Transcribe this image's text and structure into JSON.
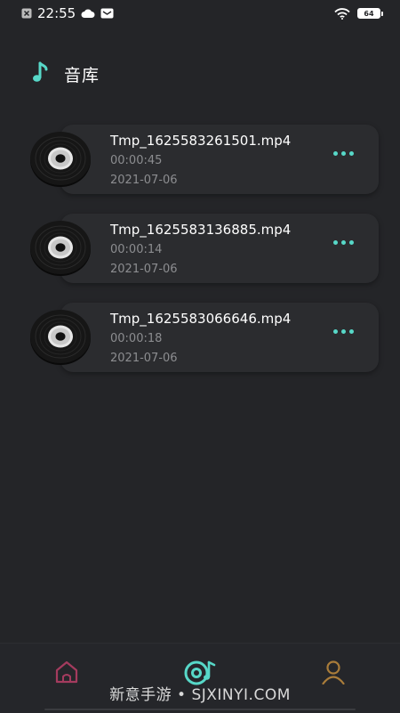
{
  "status_bar": {
    "time": "22:55",
    "battery": "64",
    "icons": [
      "close-box-icon",
      "weather-icon",
      "message-icon",
      "wifi-icon",
      "battery-icon"
    ]
  },
  "header": {
    "title": "音库",
    "icon": "music-note-icon"
  },
  "files": [
    {
      "name": "Tmp_1625583261501.mp4",
      "duration": "00:00:45",
      "date": "2021-07-06"
    },
    {
      "name": "Tmp_1625583136885.mp4",
      "duration": "00:00:14",
      "date": "2021-07-06"
    },
    {
      "name": "Tmp_1625583066646.mp4",
      "duration": "00:00:18",
      "date": "2021-07-06"
    }
  ],
  "bottom_nav": {
    "items": [
      {
        "icon": "home-icon",
        "color": "#a43b5e",
        "active": false
      },
      {
        "icon": "disc-music-icon",
        "color": "#57d8c8",
        "active": true
      },
      {
        "icon": "user-icon",
        "color": "#a97c3a",
        "active": false
      }
    ]
  },
  "watermark": "新意手游 • SJXINYI.COM",
  "colors": {
    "background": "#242528",
    "card": "#2b2c2f",
    "accent": "#57d8c8",
    "secondary_text": "#8c8d90"
  }
}
